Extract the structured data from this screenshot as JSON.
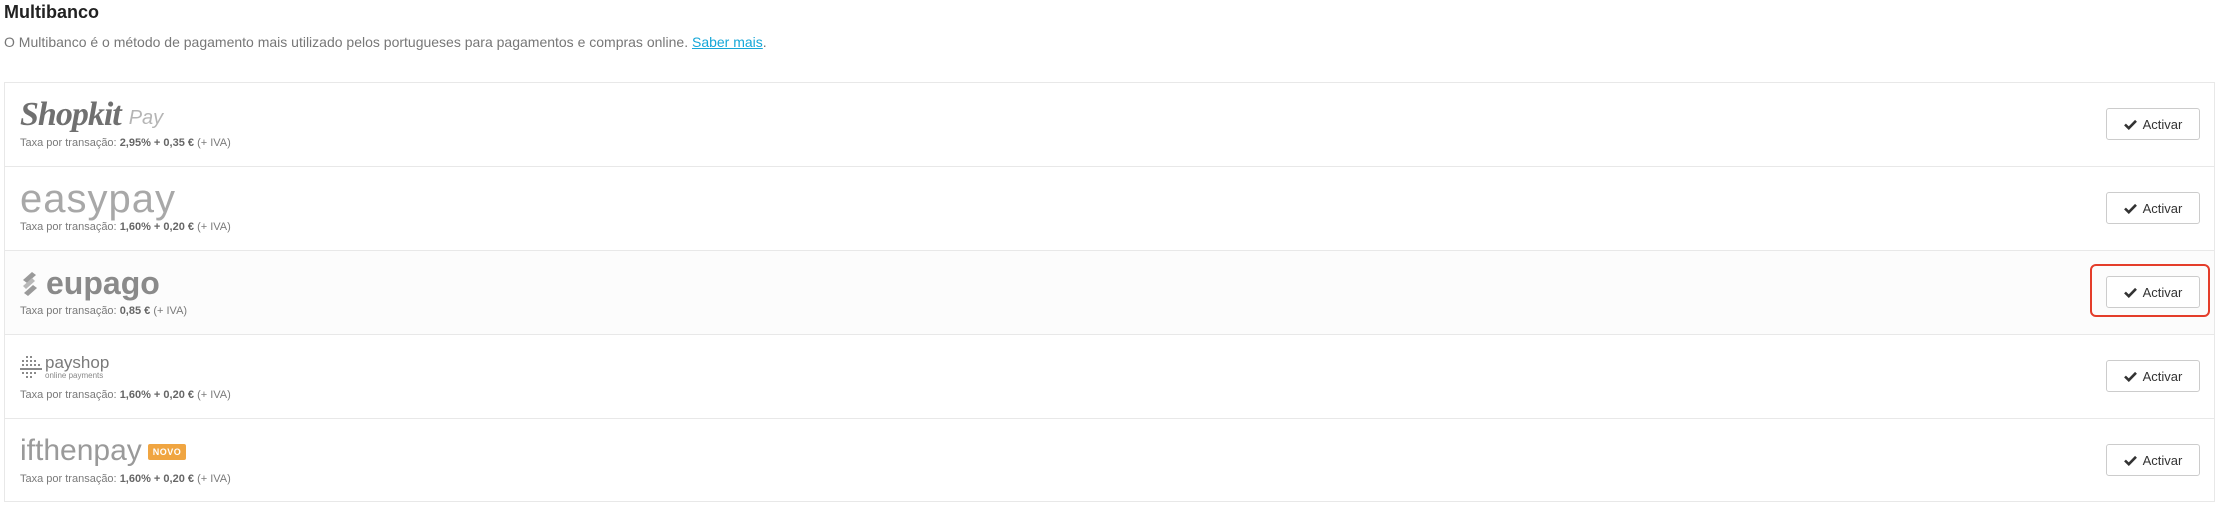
{
  "header": {
    "title": "Multibanco",
    "description": "O Multibanco é o método de pagamento mais utilizado pelos portugueses para pagamentos e compras online.",
    "link_label": "Saber mais",
    "link_suffix": "."
  },
  "providers": [
    {
      "name": "Shopkit",
      "logo_sub": "Pay",
      "fee_prefix": "Taxa por transação:",
      "fee_value": "2,95% + 0,35 €",
      "fee_suffix": "(+ IVA)",
      "button_label": "Activar"
    },
    {
      "name": "easypay",
      "fee_prefix": "Taxa por transação:",
      "fee_value": "1,60% + 0,20 €",
      "fee_suffix": "(+ IVA)",
      "button_label": "Activar"
    },
    {
      "name": "eupago",
      "fee_prefix": "Taxa por transação:",
      "fee_value": "0,85 €",
      "fee_suffix": "(+ IVA)",
      "button_label": "Activar",
      "highlighted": true
    },
    {
      "name": "payshop",
      "logo_sub": "online payments",
      "fee_prefix": "Taxa por transação:",
      "fee_value": "1,60% + 0,20 €",
      "fee_suffix": "(+ IVA)",
      "button_label": "Activar"
    },
    {
      "name": "ifthenpay",
      "badge": "NOVO",
      "fee_prefix": "Taxa por transação:",
      "fee_value": "1,60% + 0,20 €",
      "fee_suffix": "(+ IVA)",
      "button_label": "Activar"
    }
  ],
  "colors": {
    "link": "#16a7d8",
    "highlight_border": "#e43d2a",
    "badge": "#f0a541"
  },
  "icons": {
    "button_icon": "check-icon"
  }
}
